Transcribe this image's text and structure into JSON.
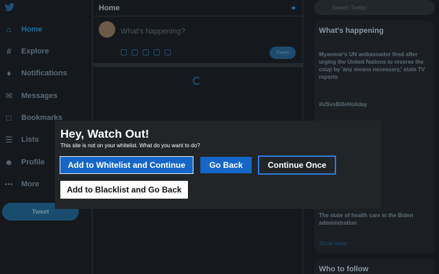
{
  "nav": {
    "items": [
      {
        "label": "Home",
        "icon": "home-icon"
      },
      {
        "label": "Explore",
        "icon": "hashtag-icon"
      },
      {
        "label": "Notifications",
        "icon": "bell-icon"
      },
      {
        "label": "Messages",
        "icon": "envelope-icon"
      },
      {
        "label": "Bookmarks",
        "icon": "bookmark-icon"
      },
      {
        "label": "Lists",
        "icon": "list-icon"
      },
      {
        "label": "Profile",
        "icon": "person-icon"
      },
      {
        "label": "More",
        "icon": "more-icon"
      }
    ],
    "tweet_label": "Tweet"
  },
  "main": {
    "title": "Home",
    "composer_placeholder": "What's happening?",
    "tweet_button": "Tweet"
  },
  "right": {
    "search_placeholder": "Search Twitter",
    "trends_title": "What's happening",
    "trends": [
      {
        "meta": "",
        "text": "Myanmar's UN ambassador fired after urging the United Nations to reverse the coup by 'any means necessary,' state TV reports"
      },
      {
        "meta": "",
        "text": "#USvsBilleHoliday"
      },
      {
        "meta": "",
        "text": "The state of health care in the Biden administration"
      }
    ],
    "show_more": "Show more",
    "who_to_follow": "Who to follow"
  },
  "dialog": {
    "title": "Hey, Watch Out!",
    "message": "This site is not on your whitelist. What do you want to do?",
    "whitelist_button": "Add to Whitelist and Continue",
    "goback_button": "Go Back",
    "once_button": "Continue Once",
    "blacklist_button": "Add to Blacklist and Go Back"
  },
  "colors": {
    "primary_button": "#1466c8",
    "dialog_bg": "#222527",
    "twitter_blue_dim": "#1d6fa5"
  }
}
